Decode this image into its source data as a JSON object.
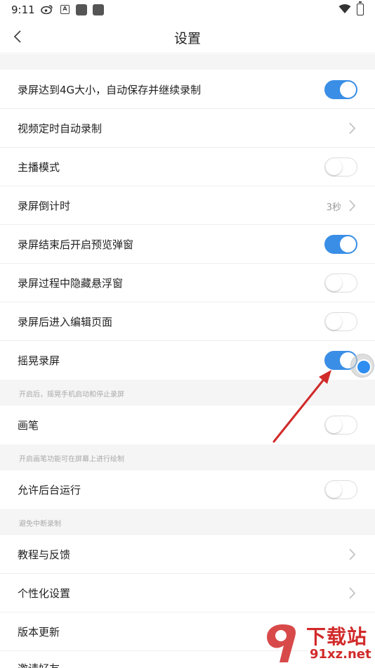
{
  "status": {
    "time": "9:11",
    "a_icon": "A"
  },
  "header": {
    "title": "设置",
    "back_icon": "chevron-left-icon"
  },
  "settings": [
    {
      "label": "录屏达到4G大小，自动保存并继续录制",
      "control": "toggle",
      "on": true
    },
    {
      "label": "视频定时自动录制",
      "control": "chevron"
    },
    {
      "label": "主播模式",
      "control": "toggle",
      "on": false
    },
    {
      "label": "录屏倒计时",
      "control": "chevron",
      "value": "3秒"
    },
    {
      "label": "录屏结束后开启预览弹窗",
      "control": "toggle",
      "on": true
    },
    {
      "label": "录屏过程中隐藏悬浮窗",
      "control": "toggle",
      "on": false
    },
    {
      "label": "录屏后进入编辑页面",
      "control": "toggle",
      "on": false
    },
    {
      "label": "摇晃录屏",
      "control": "toggle",
      "on": true,
      "hint": "开启后，摇晃手机启动和停止录屏"
    },
    {
      "label": "画笔",
      "control": "toggle",
      "on": false,
      "hint": "开启画笔功能可在屏幕上进行绘制"
    },
    {
      "label": "允许后台运行",
      "control": "toggle",
      "on": false,
      "hint": "避免中断录制"
    },
    {
      "label": "教程与反馈",
      "control": "chevron"
    },
    {
      "label": "个性化设置",
      "control": "chevron"
    },
    {
      "label": "版本更新",
      "control": "none"
    },
    {
      "label": "邀请好友",
      "control": "none"
    }
  ],
  "watermark": {
    "brand": "下载站",
    "domain": "91xz.net"
  },
  "colors": {
    "accent": "#3a8ee6",
    "annotation": "#d12a2a"
  }
}
